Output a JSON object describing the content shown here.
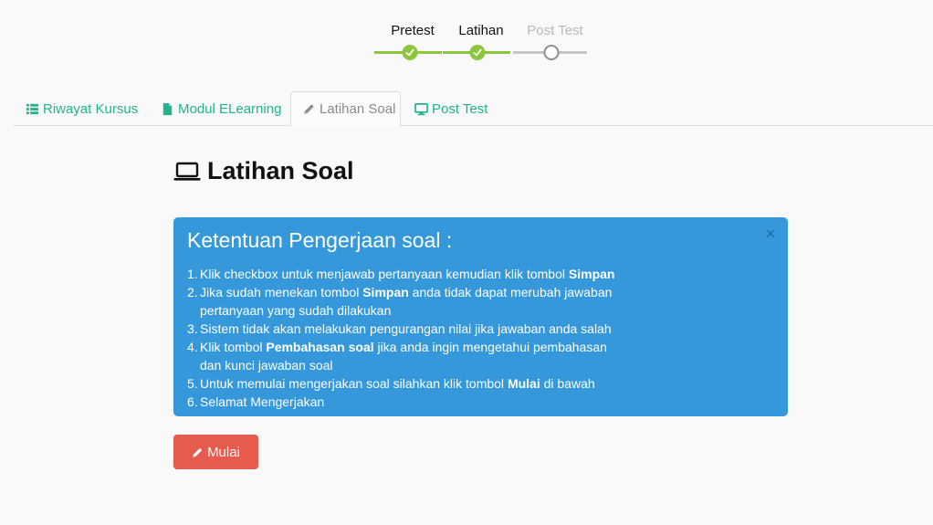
{
  "stepper": {
    "steps": [
      {
        "label": "Pretest",
        "status": "done"
      },
      {
        "label": "Latihan",
        "status": "done"
      },
      {
        "label": "Post Test",
        "status": "pending"
      }
    ]
  },
  "tabs": [
    {
      "label": "Riwayat Kursus",
      "icon": "list-icon",
      "active": false
    },
    {
      "label": "Modul ELearning",
      "icon": "file-icon",
      "active": false
    },
    {
      "label": "Latihan Soal",
      "icon": "pencil-icon",
      "active": true
    },
    {
      "label": "Post Test",
      "icon": "monitor-icon",
      "active": false
    }
  ],
  "page": {
    "title": "Latihan Soal",
    "title_icon": "laptop-icon"
  },
  "alert": {
    "title": "Ketentuan Pengerjaan soal :",
    "close": "×",
    "rules": [
      {
        "num": "1.",
        "before": "Klik checkbox untuk menjawab pertanyaan kemudian klik tombol ",
        "bold": "Simpan",
        "after": ""
      },
      {
        "num": "2.",
        "before": "Jika sudah menekan tombol ",
        "bold": "Simpan",
        "after": " anda tidak dapat merubah jawaban pertanyaan yang sudah dilakukan"
      },
      {
        "num": "3.",
        "before": "Sistem tidak akan melakukan pengurangan nilai jika jawaban anda salah",
        "bold": "",
        "after": ""
      },
      {
        "num": "4.",
        "before": "Klik tombol ",
        "bold": "Pembahasan soal",
        "after": " jika anda ingin mengetahui pembahasan dan kunci jawaban soal"
      },
      {
        "num": "5.",
        "before": "Untuk memulai mengerjakan soal silahkan klik tombol ",
        "bold": "Mulai",
        "after": " di bawah"
      },
      {
        "num": "6.",
        "before": "Selamat Mengerjakan",
        "bold": "",
        "after": ""
      }
    ]
  },
  "start_button": {
    "label": "Mulai",
    "icon": "pencil-icon"
  },
  "colors": {
    "accent": "#1fb38e",
    "step_done": "#8cc63f",
    "alert_bg": "#3498db",
    "button_bg": "#e75a4e"
  }
}
